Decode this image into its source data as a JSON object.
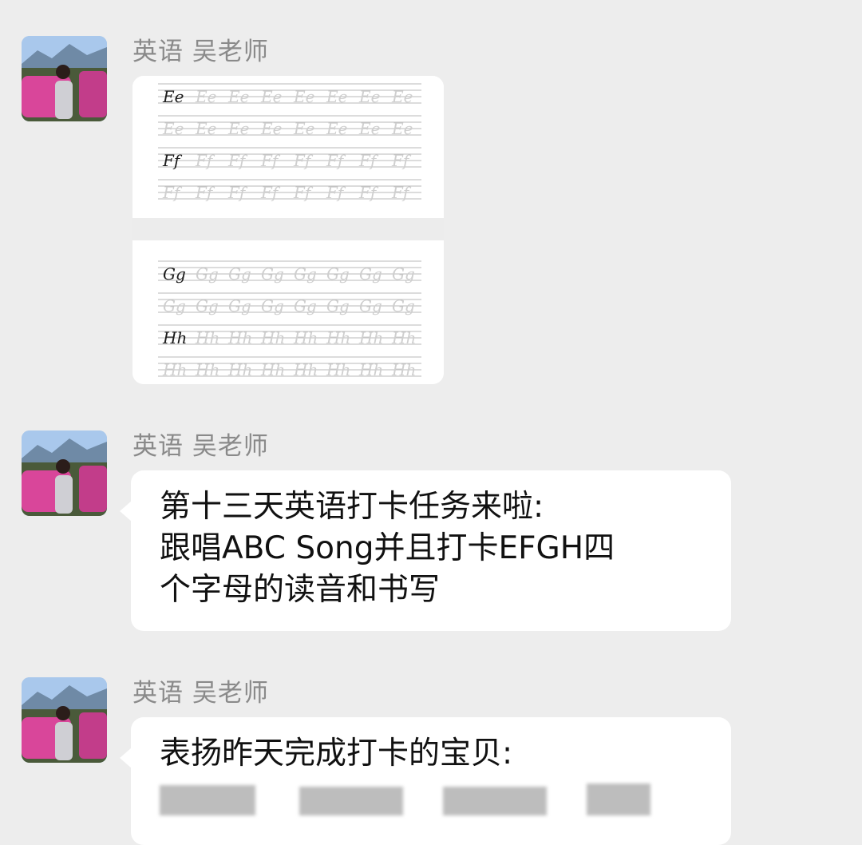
{
  "chat": {
    "messages": [
      {
        "sender": "英语 吴老师",
        "type": "image",
        "image": {
          "rows": [
            {
              "upper": "E",
              "lower": "e"
            },
            {
              "upper": "F",
              "lower": "f"
            },
            {
              "upper": "G",
              "lower": "g"
            },
            {
              "upper": "H",
              "lower": "h"
            }
          ]
        }
      },
      {
        "sender": "英语 吴老师",
        "type": "text",
        "text": "第十三天英语打卡任务来啦:\n跟唱ABC Song并且打卡EFGH四\n个字母的读音和书写"
      },
      {
        "sender": "英语 吴老师",
        "type": "text",
        "text": "表扬昨天完成打卡的宝贝:"
      }
    ]
  },
  "colors": {
    "background": "#ededed",
    "bubble": "#ffffff",
    "sender_name": "#8a8a8a",
    "text": "#111111"
  },
  "icons": {
    "avatar": "avatar-photo-woman-pink-car"
  }
}
